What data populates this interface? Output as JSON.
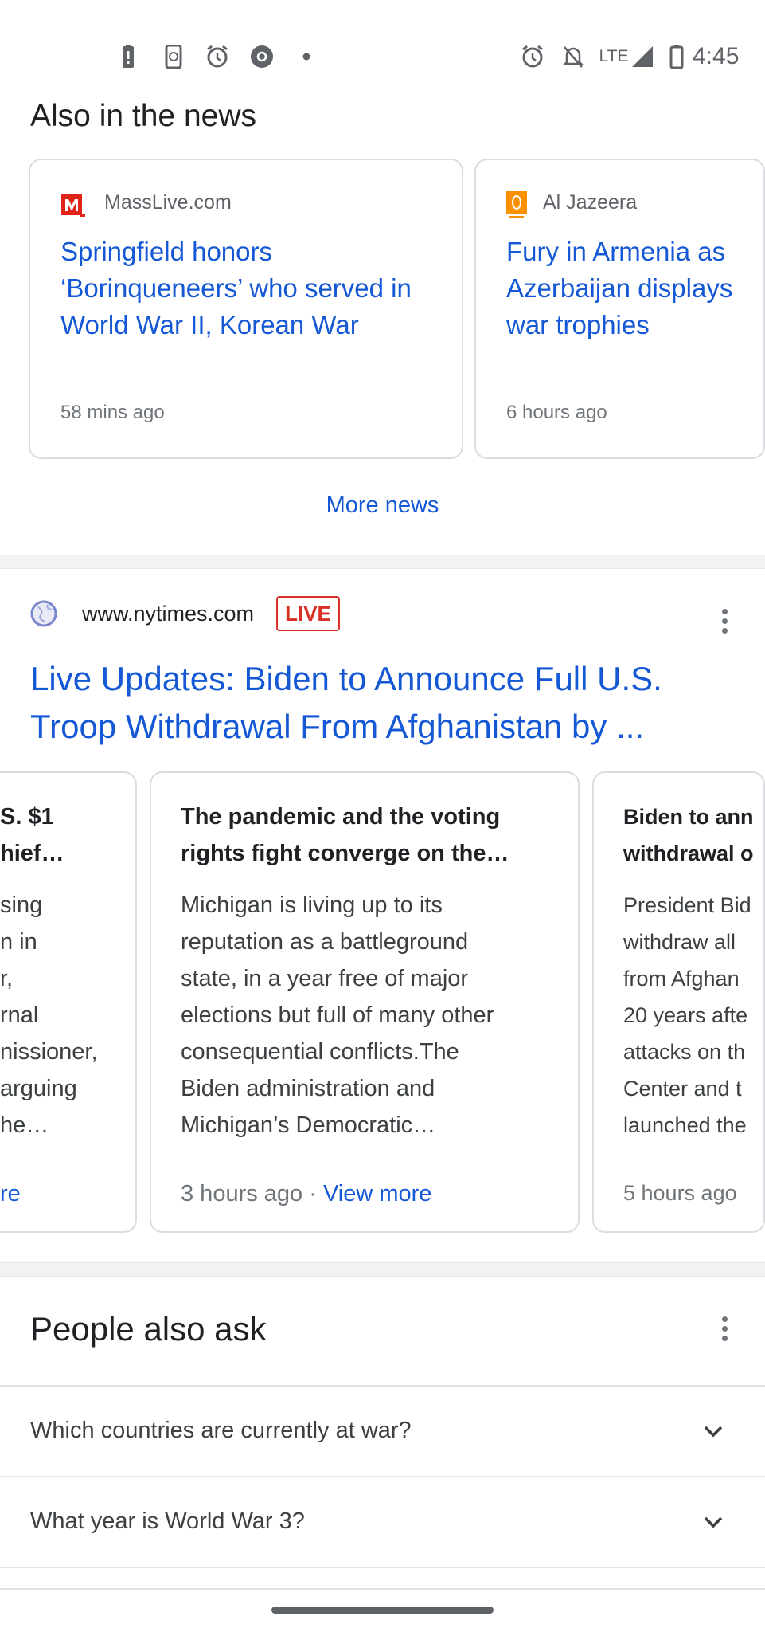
{
  "status_bar": {
    "left_icons": [
      "battery-alert-icon",
      "phone-sync-icon",
      "alarm-icon",
      "chrome-icon",
      "dot-icon"
    ],
    "right_icons": [
      "alarm-icon",
      "notifications-off-icon",
      "lte-signal-icon",
      "battery-icon"
    ],
    "network": "LTE",
    "time": "4:45"
  },
  "also_in_news": {
    "title": "Also in the news",
    "cards": [
      {
        "source": "MassLive.com",
        "source_icon": "masslive-logo",
        "headline": "Springfield honors ‘Borinqueneers’ who served in World War II, Korean War",
        "time": "58 mins ago"
      },
      {
        "source": "Al Jazeera",
        "source_icon": "al-jazeera-logo",
        "headline": "Fury in Armenia as Azerbaijan displays war trophies",
        "headline_visible": [
          "Fury in Armenia as",
          "Azerbaijan displays",
          "trophies"
        ],
        "time": "6 hours ago"
      }
    ],
    "more_news": "More news"
  },
  "result": {
    "site": "www.nytimes.com",
    "badge": "LIVE",
    "title_lines": [
      "Live Updates: Biden to Announce Full U.S.",
      "Troop Withdrawal From Afghanistan by ..."
    ],
    "cards": [
      {
        "title_lines": [
          "S. $1",
          "hief…"
        ],
        "body_lines": [
          "sing",
          "n in",
          "r,",
          "rnal",
          "nissioner,",
          "arguing",
          "he…"
        ],
        "link": "re"
      },
      {
        "title_lines": [
          "The pandemic and the voting",
          "rights fight converge on the…"
        ],
        "body_lines": [
          "Michigan is living up to its",
          "reputation as a battleground",
          "state, in a year free of major",
          "elections but full of many other",
          "consequential conflicts.The",
          "Biden administration and",
          "Michigan’s Democratic…"
        ],
        "time": "3 hours ago",
        "sep": " · ",
        "link": "View more"
      },
      {
        "title_lines": [
          "Biden to ann",
          "withdrawal o"
        ],
        "body_lines": [
          "President Bid",
          "withdraw all",
          "from Afghan",
          "20 years afte",
          "attacks on th",
          "Center and t",
          "launched the"
        ],
        "time": "5 hours ago"
      }
    ]
  },
  "people_also_ask": {
    "title": "People also ask",
    "questions": [
      "Which countries are currently at war?",
      "What year is World War 3?"
    ]
  },
  "colors": {
    "link": "#1558d6",
    "live": "#d93025",
    "masslive": "#e2231a",
    "aljazeera": "#fa9000"
  }
}
